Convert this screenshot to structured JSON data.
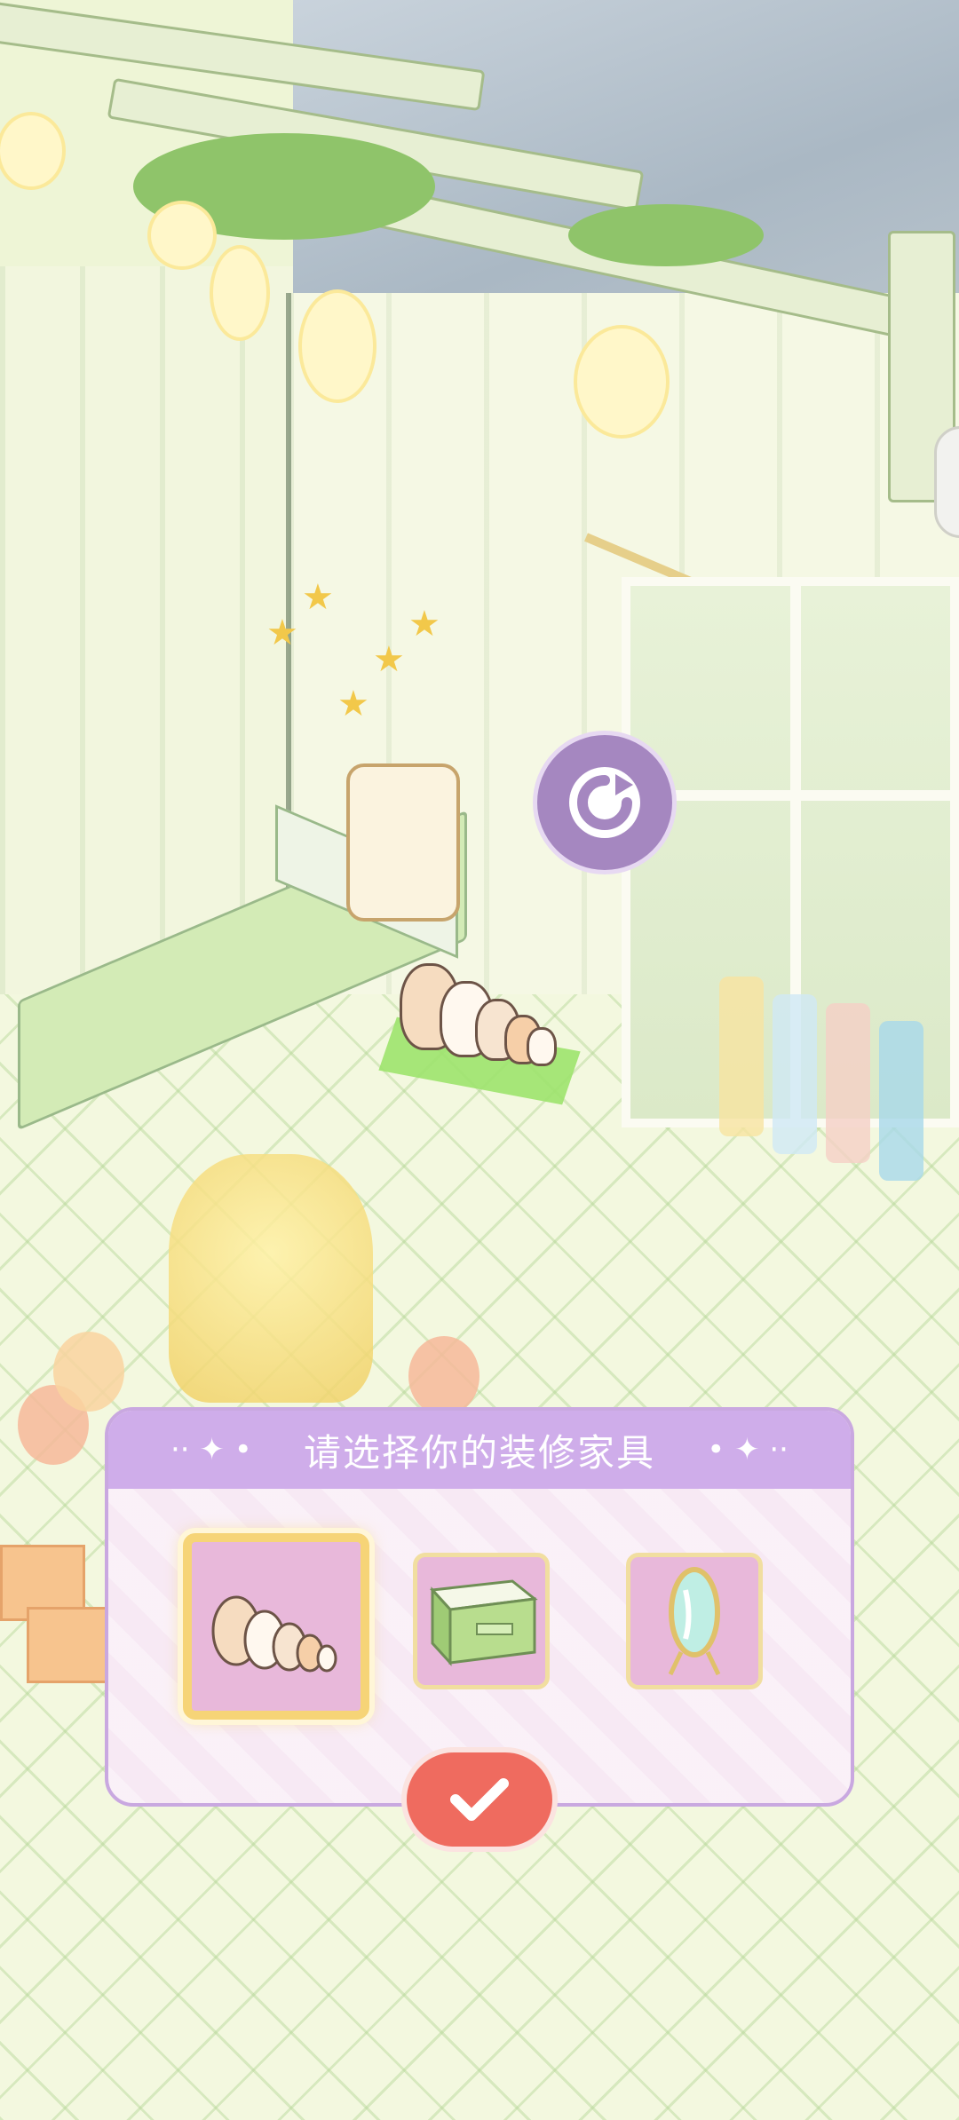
{
  "dialog": {
    "title": "请选择你的装修家具",
    "options": [
      {
        "name": "cat-family-sofa",
        "selected": true
      },
      {
        "name": "green-cabinet",
        "selected": false
      },
      {
        "name": "standing-mirror",
        "selected": false
      }
    ]
  },
  "colors": {
    "panel_header": "#cfadea",
    "panel_bg": "#f7e9f4",
    "confirm": "#ef6b5f",
    "rotate": "#a587c0",
    "placement_marker": "#9de36d"
  },
  "icons": {
    "rotate": "rotate-icon",
    "confirm": "checkmark-icon"
  }
}
